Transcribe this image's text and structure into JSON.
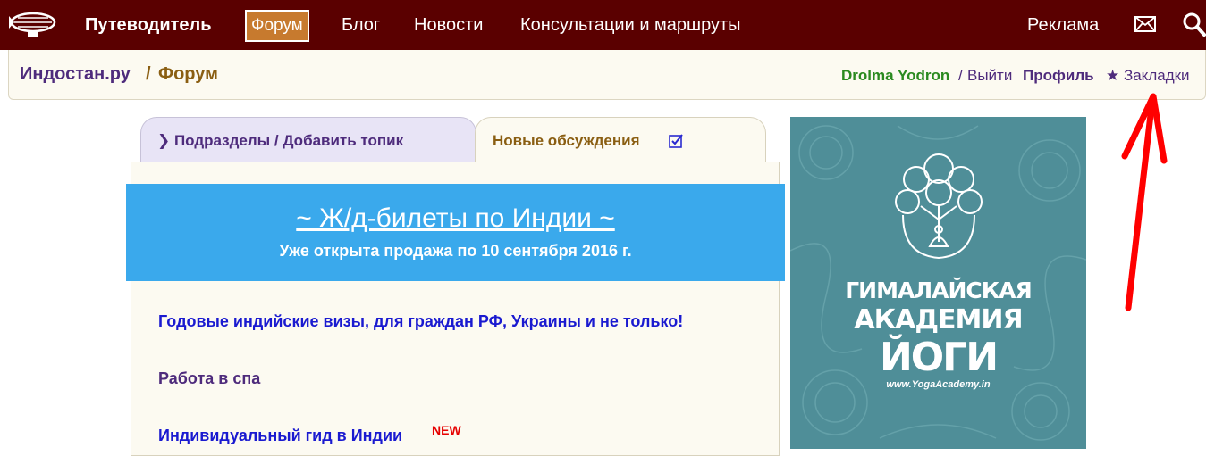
{
  "nav": {
    "items": [
      {
        "label": "Путеводитель"
      },
      {
        "label": "Форум",
        "active": true
      },
      {
        "label": "Блог"
      },
      {
        "label": "Новости"
      },
      {
        "label": "Консультации и маршруты"
      }
    ],
    "ads_label": "Реклама",
    "icons": [
      "airship-logo-icon",
      "mail-icon",
      "search-icon"
    ]
  },
  "breadcrumb": {
    "site": "Индостан.ру",
    "separator": "/",
    "section": "Форум"
  },
  "user": {
    "name": "Drolma Yodron",
    "separator": "/",
    "logout": "Выйти",
    "profile": "Профиль",
    "bookmarks": "★ Закладки"
  },
  "tabs": [
    {
      "label": "❯ Подразделы / Добавить топик"
    },
    {
      "label": "Новые обсуждения",
      "active": true
    }
  ],
  "banner": {
    "title": "~ Ж/д-билеты по Индии ~",
    "subtitle": "Уже открыта продажа по 10 сентября 2016 г."
  },
  "topics": [
    {
      "title": "Годовые индийские визы, для граждан РФ, Украины и не только!"
    },
    {
      "title": "Работа в спа"
    },
    {
      "title": "Индивидуальный гид в Индии",
      "badge": "NEW"
    }
  ],
  "ad": {
    "line1": "ГИМАЛАЙСКАЯ",
    "line2": "АКАДЕМИЯ",
    "line3": "ЙОГИ",
    "url": "www.YogaAcademy.in"
  },
  "colors": {
    "topbar": "#5a0000",
    "active_nav": "#c77a2e",
    "banner": "#3aa9ec",
    "ad": "#4f8e98",
    "annotation_arrow": "#ff0000"
  }
}
